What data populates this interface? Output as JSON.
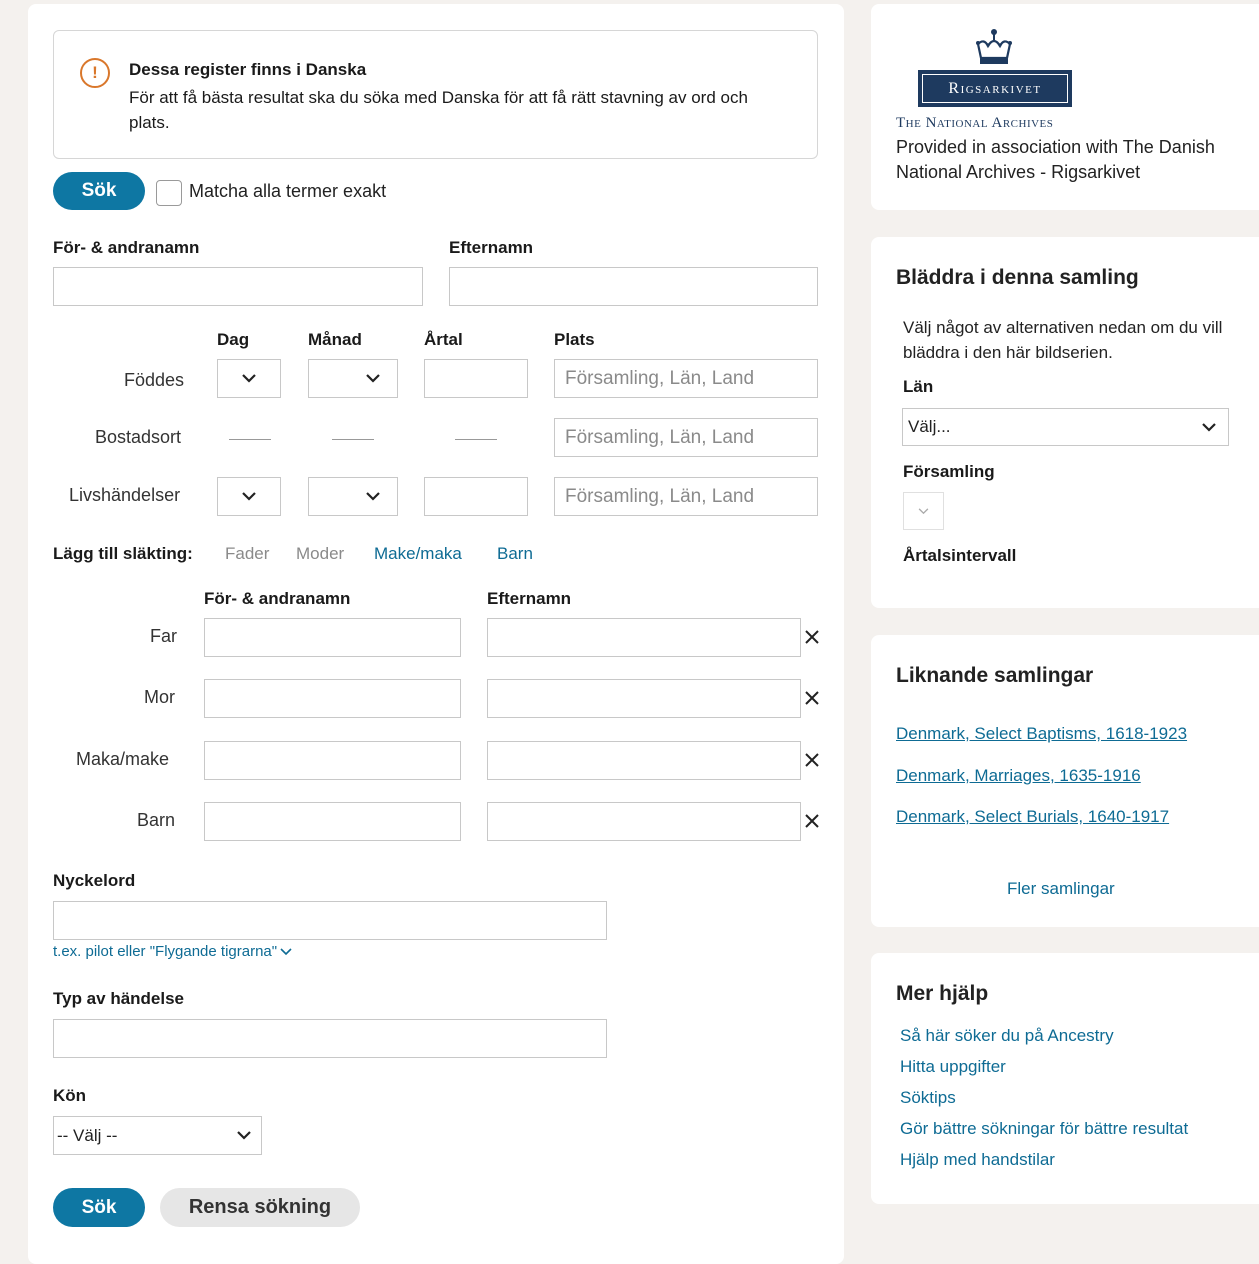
{
  "notice": {
    "title": "Dessa register finns i Danska",
    "text": "För att få bästa resultat ska du söka med Danska för att få rätt stavning av ord och plats.",
    "icon": "alert-circle-icon"
  },
  "search_top": {
    "button": "Sök",
    "exact_label": "Matcha alla termer exakt"
  },
  "name": {
    "first_label": "För- & andranamn",
    "last_label": "Efternamn"
  },
  "events": {
    "col_day": "Dag",
    "col_month": "Månad",
    "col_year": "Årtal",
    "col_place": "Plats",
    "rows": [
      {
        "label": "Föddes",
        "place_placeholder": "Församling, Län, Land"
      },
      {
        "label": "Bostadsort",
        "place_placeholder": "Församling, Län, Land"
      },
      {
        "label": "Livshändelser",
        "place_placeholder": "Församling, Län, Land"
      }
    ]
  },
  "relatives": {
    "add_label": "Lägg till släkting:",
    "options": [
      {
        "label": "Fader",
        "active": false
      },
      {
        "label": "Moder",
        "active": false
      },
      {
        "label": "Make/maka",
        "active": true
      },
      {
        "label": "Barn",
        "active": true
      }
    ],
    "col_first": "För- & andranamn",
    "col_last": "Efternamn",
    "rows": [
      {
        "label": "Far"
      },
      {
        "label": "Mor"
      },
      {
        "label": "Maka/make"
      },
      {
        "label": "Barn"
      }
    ]
  },
  "keyword": {
    "label": "Nyckelord",
    "hint": "t.ex. pilot eller \"Flygande tigrarna\""
  },
  "event_type": {
    "label": "Typ av händelse"
  },
  "gender": {
    "label": "Kön",
    "selected": "-- Välj --"
  },
  "bottom": {
    "search": "Sök",
    "clear": "Rensa sökning"
  },
  "sidebar": {
    "archive": {
      "logo_text": "Rigsarkivet",
      "subtitle": "The National Archives",
      "provided": "Provided in association with The Danish National Archives - Rigsarkivet"
    },
    "browse": {
      "title": "Bläddra i denna samling",
      "text": "Välj något av alternativen nedan om du vill bläddra i den här bildserien.",
      "county_label": "Län",
      "county_selected": "Välj...",
      "parish_label": "Församling",
      "years_label": "Årtalsintervall"
    },
    "similar": {
      "title": "Liknande samlingar",
      "links": [
        "Denmark, Select Baptisms, 1618-1923",
        "Denmark, Marriages, 1635-1916",
        "Denmark, Select Burials, 1640-1917"
      ],
      "more": "Fler samlingar"
    },
    "help": {
      "title": "Mer hjälp",
      "links": [
        "Så här söker du på Ancestry",
        "Hitta uppgifter",
        "Söktips",
        "Gör bättre sökningar för bättre resultat",
        "Hjälp med handstilar"
      ]
    }
  },
  "colors": {
    "accent": "#0e77a3",
    "link": "#0e6b94",
    "warning": "#d9772b"
  }
}
